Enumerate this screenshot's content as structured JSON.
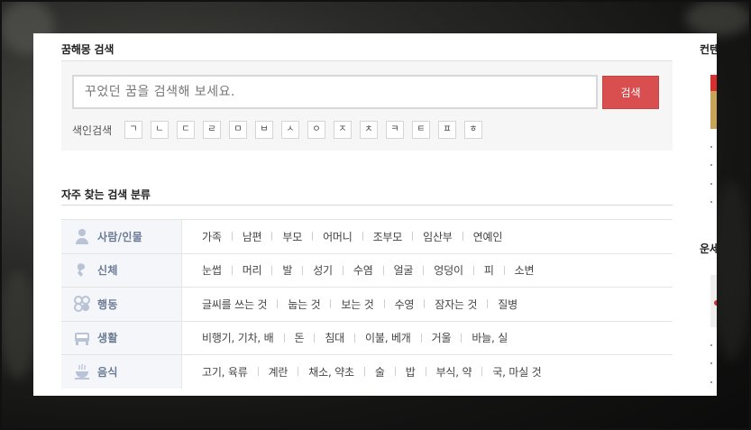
{
  "search": {
    "title": "꿈해몽 검색",
    "placeholder": "꾸었던 꿈을 검색해 보세요.",
    "button_label": "검색",
    "index_label": "색인검색",
    "index_keys": [
      "ㄱ",
      "ㄴ",
      "ㄷ",
      "ㄹ",
      "ㅁ",
      "ㅂ",
      "ㅅ",
      "ㅇ",
      "ㅈ",
      "ㅊ",
      "ㅋ",
      "ㅌ",
      "ㅍ",
      "ㅎ"
    ]
  },
  "categories": {
    "title": "자주 찾는 검색 분류",
    "rows": [
      {
        "name": "사람/인물",
        "icon": "person-icon",
        "items": [
          "가족",
          "남편",
          "부모",
          "어머니",
          "조부모",
          "임산부",
          "연예인"
        ]
      },
      {
        "name": "신체",
        "icon": "body-icon",
        "items": [
          "눈썹",
          "머리",
          "발",
          "성기",
          "수염",
          "얼굴",
          "엉덩이",
          "피",
          "소변"
        ]
      },
      {
        "name": "행동",
        "icon": "action-icon",
        "items": [
          "글씨를 쓰는 것",
          "눕는 것",
          "보는 것",
          "수영",
          "잠자는 것",
          "질병"
        ]
      },
      {
        "name": "생활",
        "icon": "life-icon",
        "items": [
          "비행기, 기차, 배",
          "돈",
          "침대",
          "이불, 베개",
          "거울",
          "바늘, 실"
        ]
      },
      {
        "name": "음식",
        "icon": "food-icon",
        "items": [
          "고기, 육류",
          "계란",
          "채소, 약초",
          "술",
          "밥",
          "부식, 약",
          "국, 마실 것"
        ]
      }
    ]
  },
  "sidebar": {
    "title1": "컨텐",
    "title2": "운세"
  },
  "colors": {
    "accent": "#d94f4f",
    "category_text": "#6b7a95",
    "category_bg": "#f4f6f9"
  }
}
